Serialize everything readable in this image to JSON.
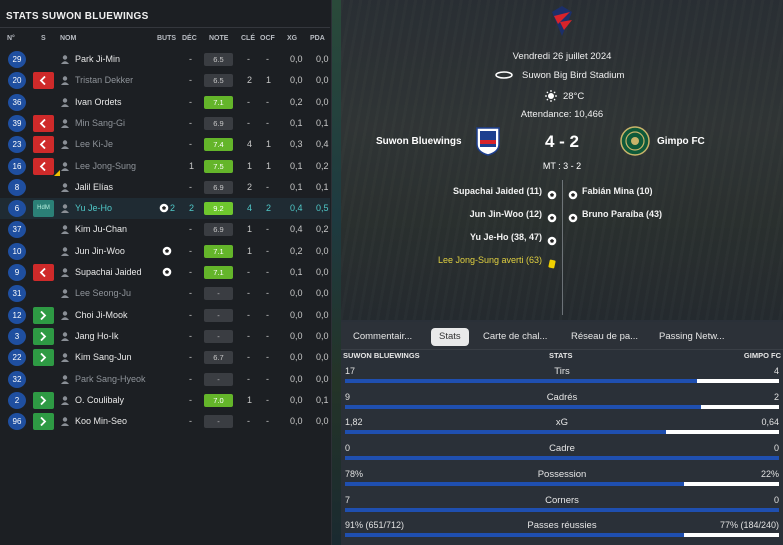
{
  "left": {
    "title": "STATS SUWON BLUEWINGS",
    "headers": {
      "num": "N°",
      "s": "S",
      "nom": "NOM",
      "buts": "BUTS",
      "dec": "DÉC",
      "note": "NOTE",
      "cle": "CLÉ",
      "ocf": "OCF",
      "xg": "XG",
      "pda": "PDA"
    },
    "players": [
      {
        "num": "29",
        "sub": "",
        "name": "Park Ji-Min",
        "goals": "",
        "dec": "-",
        "note": "6.5",
        "rcolor": "grey",
        "cle": "-",
        "ocf": "-",
        "xg": "0,0",
        "pda": "0,0",
        "dim": false
      },
      {
        "num": "20",
        "sub": "out",
        "name": "Tristan Dekker",
        "goals": "",
        "dec": "-",
        "note": "6.5",
        "rcolor": "grey",
        "cle": "2",
        "ocf": "1",
        "xg": "0,0",
        "pda": "0,0",
        "dim": true
      },
      {
        "num": "36",
        "sub": "",
        "name": "Ivan Ordets",
        "goals": "",
        "dec": "-",
        "note": "7.1",
        "rcolor": "green",
        "cle": "-",
        "ocf": "-",
        "xg": "0,2",
        "pda": "0,0",
        "dim": false
      },
      {
        "num": "39",
        "sub": "out",
        "name": "Min Sang-Gi",
        "goals": "",
        "dec": "-",
        "note": "6.9",
        "rcolor": "grey",
        "cle": "-",
        "ocf": "-",
        "xg": "0,1",
        "pda": "0,1",
        "dim": true
      },
      {
        "num": "23",
        "sub": "out",
        "name": "Lee Ki-Je",
        "goals": "",
        "dec": "-",
        "note": "7.4",
        "rcolor": "green",
        "cle": "4",
        "ocf": "1",
        "xg": "0,3",
        "pda": "0,4",
        "dim": true
      },
      {
        "num": "16",
        "sub": "out",
        "name": "Lee Jong-Sung",
        "goals": "",
        "dec": "1",
        "note": "7.5",
        "rcolor": "green",
        "cle": "1",
        "ocf": "1",
        "xg": "0,1",
        "pda": "0,2",
        "dim": true,
        "yellow": true
      },
      {
        "num": "8",
        "sub": "",
        "name": "Jalil Elías",
        "goals": "",
        "dec": "-",
        "note": "6.9",
        "rcolor": "grey",
        "cle": "2",
        "ocf": "-",
        "xg": "0,1",
        "pda": "0,1",
        "dim": false
      },
      {
        "num": "6",
        "sub": "tag",
        "tag": "HdM",
        "name": "Yu Je-Ho",
        "goals": "2",
        "dec": "2",
        "note": "9.2",
        "rcolor": "bright",
        "cle": "4",
        "ocf": "2",
        "xg": "0,4",
        "pda": "0,5",
        "dim": false,
        "hl": true
      },
      {
        "num": "37",
        "sub": "",
        "name": "Kim Ju-Chan",
        "goals": "",
        "dec": "-",
        "note": "6.9",
        "rcolor": "grey",
        "cle": "1",
        "ocf": "-",
        "xg": "0,4",
        "pda": "0,2",
        "dim": false
      },
      {
        "num": "10",
        "sub": "",
        "name": "Jun Jin-Woo",
        "goals": "ball",
        "dec": "-",
        "note": "7.1",
        "rcolor": "green",
        "cle": "1",
        "ocf": "-",
        "xg": "0,2",
        "pda": "0,0",
        "dim": false
      },
      {
        "num": "9",
        "sub": "out",
        "name": "Supachai Jaided",
        "goals": "ball",
        "dec": "-",
        "note": "7.1",
        "rcolor": "green",
        "cle": "-",
        "ocf": "-",
        "xg": "0,1",
        "pda": "0,0",
        "dim": false
      },
      {
        "num": "31",
        "sub": "",
        "name": "Lee Seong-Ju",
        "goals": "",
        "dec": "-",
        "note": "-",
        "rcolor": "grey",
        "cle": "-",
        "ocf": "-",
        "xg": "0,0",
        "pda": "0,0",
        "dim": true
      },
      {
        "num": "12",
        "sub": "in",
        "name": "Choi Ji-Mook",
        "goals": "",
        "dec": "-",
        "note": "-",
        "rcolor": "grey",
        "cle": "-",
        "ocf": "-",
        "xg": "0,0",
        "pda": "0,0",
        "dim": false
      },
      {
        "num": "3",
        "sub": "in",
        "name": "Jang Ho-Ik",
        "goals": "",
        "dec": "-",
        "note": "-",
        "rcolor": "grey",
        "cle": "-",
        "ocf": "-",
        "xg": "0,0",
        "pda": "0,0",
        "dim": false
      },
      {
        "num": "22",
        "sub": "in",
        "name": "Kim Sang-Jun",
        "goals": "",
        "dec": "-",
        "note": "6.7",
        "rcolor": "grey",
        "cle": "-",
        "ocf": "-",
        "xg": "0,0",
        "pda": "0,0",
        "dim": false
      },
      {
        "num": "32",
        "sub": "",
        "name": "Park Sang-Hyeok",
        "goals": "",
        "dec": "-",
        "note": "-",
        "rcolor": "grey",
        "cle": "-",
        "ocf": "-",
        "xg": "0,0",
        "pda": "0,0",
        "dim": true
      },
      {
        "num": "2",
        "sub": "in",
        "name": "O. Coulibaly",
        "goals": "",
        "dec": "-",
        "note": "7.0",
        "rcolor": "green",
        "cle": "1",
        "ocf": "-",
        "xg": "0,0",
        "pda": "0,1",
        "dim": false
      },
      {
        "num": "96",
        "sub": "in",
        "name": "Koo Min-Seo",
        "goals": "",
        "dec": "-",
        "note": "-",
        "rcolor": "grey",
        "cle": "-",
        "ocf": "-",
        "xg": "0,0",
        "pda": "0,0",
        "dim": false
      }
    ]
  },
  "match": {
    "date": "Vendredi 26 juillet 2024",
    "stadium": "Suwon Big Bird Stadium",
    "temp": "28°C",
    "attendance": "Attendance: 10,466",
    "home": "Suwon Bluewings",
    "away": "Gimpo FC",
    "score": "4 - 2",
    "ht": "MT : 3 - 2",
    "home_events": [
      {
        "text": "Supachai Jaided (11)",
        "type": "goal"
      },
      {
        "text": "Jun Jin-Woo (12)",
        "type": "goal"
      },
      {
        "text": "Yu Je-Ho (38, 47)",
        "type": "goal"
      },
      {
        "text": "Lee Jong-Sung averti (63)",
        "type": "yellow"
      }
    ],
    "away_events": [
      {
        "text": "Fabián Mina (10)",
        "type": "goal"
      },
      {
        "text": "Bruno Paraíba (43)",
        "type": "goal"
      }
    ]
  },
  "tabs": [
    "Commentair...",
    "Stats",
    "Carte de chal...",
    "Réseau de pa...",
    "Passing Netw..."
  ],
  "active_tab": "Stats",
  "stats": {
    "home_label": "SUWON BLUEWINGS",
    "mid_label": "STATS",
    "away_label": "GIMPO FC",
    "rows": [
      {
        "label": "Tirs",
        "home": "17",
        "away": "4",
        "frac": 0.81
      },
      {
        "label": "Cadrés",
        "home": "9",
        "away": "2",
        "frac": 0.82
      },
      {
        "label": "xG",
        "home": "1,82",
        "away": "0,64",
        "frac": 0.74
      },
      {
        "label": "Cadre",
        "home": "0",
        "away": "0",
        "frac": 1.0
      },
      {
        "label": "Possession",
        "home": "78%",
        "away": "22%",
        "frac": 0.78
      },
      {
        "label": "Corners",
        "home": "7",
        "away": "0",
        "frac": 1.0
      },
      {
        "label": "Passes réussies",
        "home": "91% (651/712)",
        "away": "77% (184/240)",
        "frac": 0.78
      }
    ]
  },
  "colors": {
    "home_blue": "#1f4fb0",
    "rating_green": "#64b52a",
    "sub_out": "#cf2a2a",
    "sub_in": "#2e9a44",
    "highlight": "#4fc8c8"
  }
}
